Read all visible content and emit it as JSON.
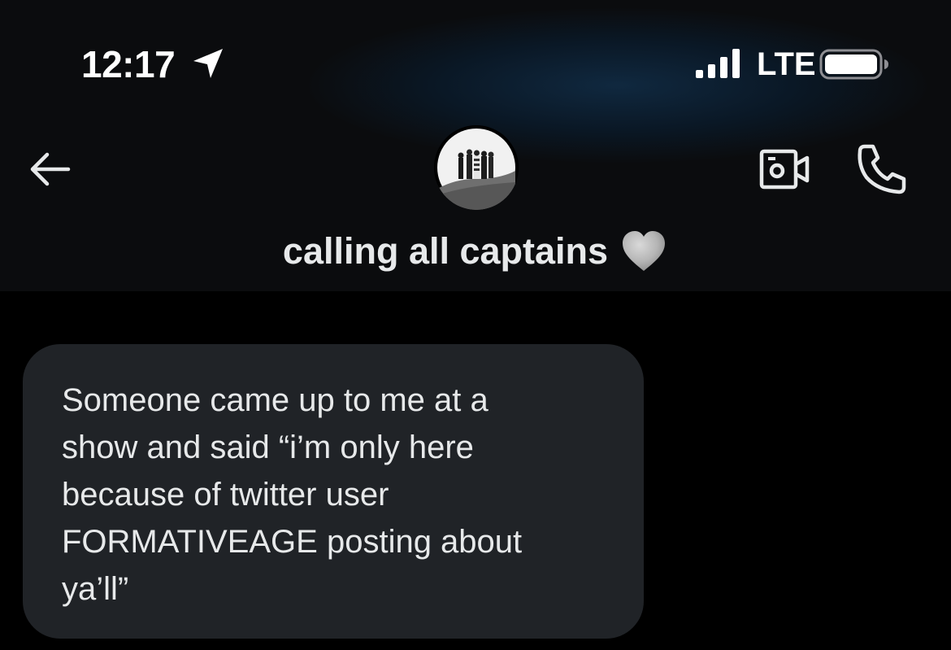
{
  "status_bar": {
    "time": "12:17",
    "location_icon": "location-arrow-icon",
    "signal_icon": "cellular-signal-icon",
    "network": "LTE",
    "battery_icon": "battery-icon"
  },
  "header": {
    "back_icon": "arrow-left-icon",
    "avatar_icon": "group-avatar-photo",
    "video_icon": "video-camera-icon",
    "phone_icon": "phone-icon",
    "title": "calling all captains",
    "title_emoji_icon": "grey-heart-icon"
  },
  "conversation": {
    "messages": [
      {
        "direction": "received",
        "text": "Someone came up to me at a\nshow and said “i’m only here\nbecause of twitter user\nFORMATIVEAGE posting about\nya’ll”"
      }
    ]
  },
  "colors": {
    "background": "#000000",
    "header_background": "#0b0c0e",
    "bubble_background": "#202327",
    "text": "#e7e9ea"
  }
}
